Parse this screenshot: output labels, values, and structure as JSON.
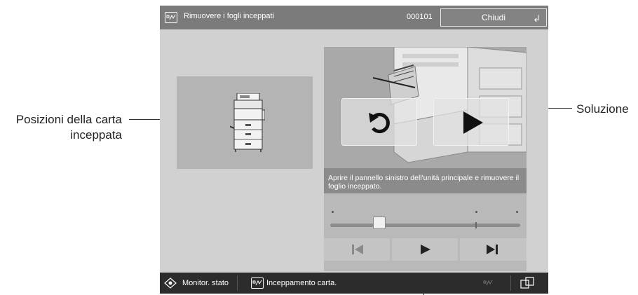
{
  "callouts": {
    "left": "Posizioni della carta inceppata",
    "right": "Soluzione"
  },
  "header": {
    "title": "Rimuovere i fogli inceppati",
    "code": "000101",
    "close_label": "Chiudi"
  },
  "video": {
    "caption": "Aprire il pannello sinistro dell'unità principale e rimuovere il foglio inceppato.",
    "progress": 0.26
  },
  "footer": {
    "status_monitor": "Monitor. stato",
    "jam_message": "Inceppamento carta."
  },
  "colors": {
    "header_bg": "#7b7b7b",
    "footer_bg": "#2c2c2c",
    "panel_bg": "#d1d1d1"
  },
  "icons": [
    "jam-icon",
    "enter-icon",
    "printer-icon",
    "replay-icon",
    "play-icon",
    "skip-start-icon",
    "skip-end-icon",
    "eye-icon",
    "wrench-icon",
    "swap-icon"
  ]
}
